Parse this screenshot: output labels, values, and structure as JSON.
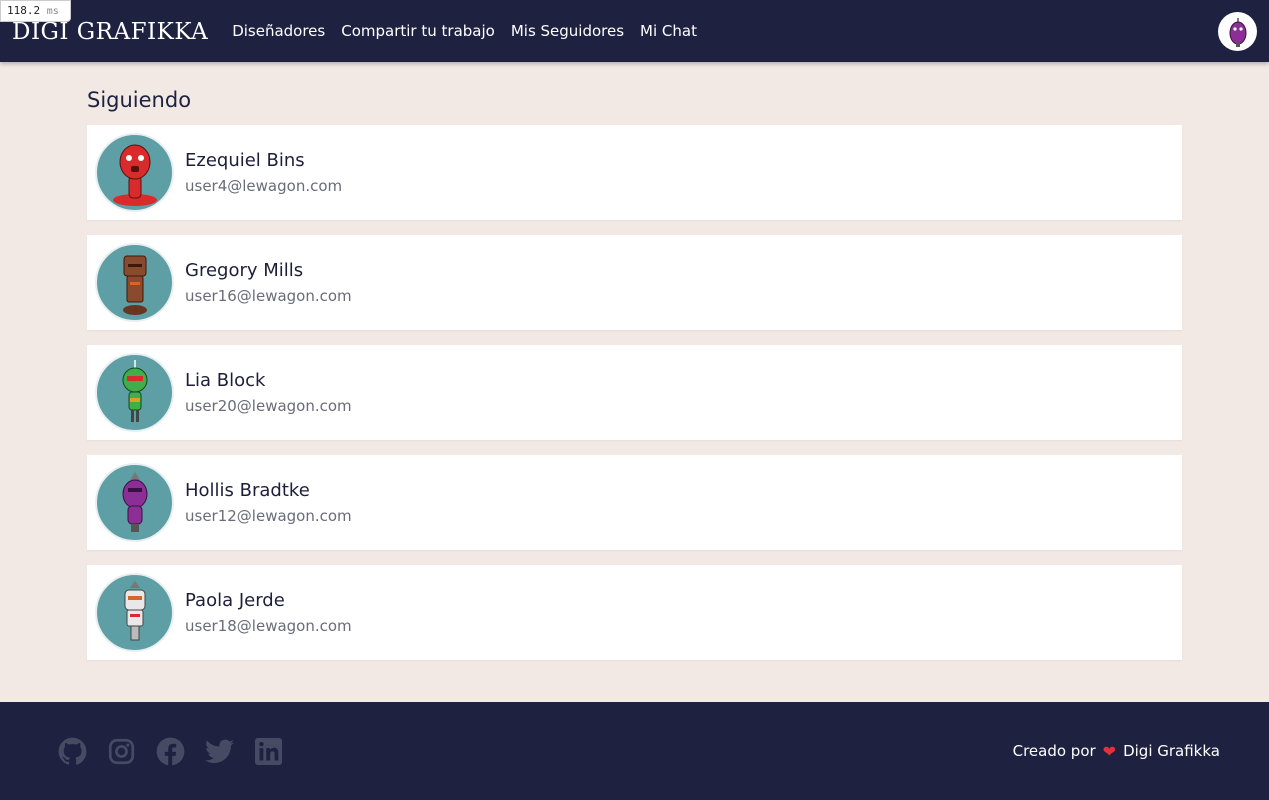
{
  "timing": {
    "value": "118.2",
    "unit": "ms"
  },
  "navbar": {
    "brand": "DIGI GRAFIKKA",
    "links": [
      {
        "label": "Diseñadores"
      },
      {
        "label": "Compartir tu trabajo"
      },
      {
        "label": "Mis Seguidores"
      },
      {
        "label": "Mi Chat"
      }
    ]
  },
  "page": {
    "title": "Siguiendo"
  },
  "following": [
    {
      "name": "Ezequiel Bins",
      "email": "user4@lewagon.com",
      "robot_color": "#d92b2b"
    },
    {
      "name": "Gregory Mills",
      "email": "user16@lewagon.com",
      "robot_color": "#8a4a2e"
    },
    {
      "name": "Lia Block",
      "email": "user20@lewagon.com",
      "robot_color": "#3fae4b"
    },
    {
      "name": "Hollis Bradtke",
      "email": "user12@lewagon.com",
      "robot_color": "#8b2f96"
    },
    {
      "name": "Paola Jerde",
      "email": "user18@lewagon.com",
      "robot_color": "#e8e8e8"
    }
  ],
  "footer": {
    "socials": [
      "github-icon",
      "instagram-icon",
      "facebook-icon",
      "twitter-icon",
      "linkedin-icon"
    ],
    "credit_prefix": "Creado por",
    "credit_name": "Digi Grafikka",
    "heart_color": "#e0313c"
  }
}
